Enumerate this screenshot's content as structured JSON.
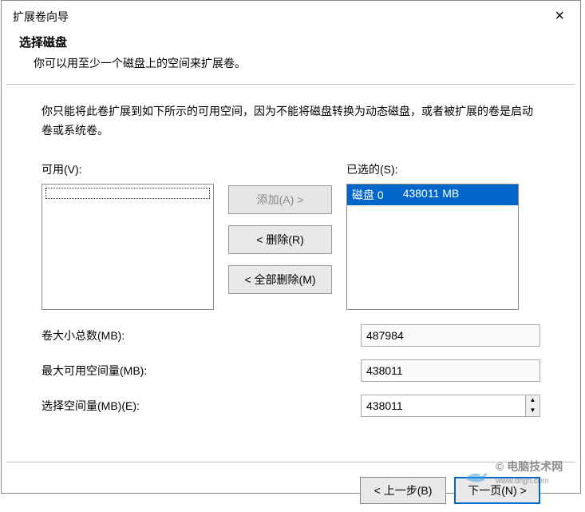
{
  "window": {
    "title": "扩展卷向导",
    "close_icon": "×"
  },
  "header": {
    "title": "选择磁盘",
    "description": "你可以用至少一个磁盘上的空间来扩展卷。"
  },
  "info": "你只能将此卷扩展到如下所示的可用空间，因为不能将磁盘转换为动态磁盘，或者被扩展的卷是启动卷或系统卷。",
  "available": {
    "label": "可用(V):"
  },
  "selected": {
    "label": "已选的(S):",
    "items": [
      {
        "disk": "磁盘 0",
        "size": "438011 MB"
      }
    ]
  },
  "buttons": {
    "add": "添加(A) >",
    "remove": "< 删除(R)",
    "remove_all": "< 全部删除(M)"
  },
  "fields": {
    "total_size": {
      "label": "卷大小总数(MB):",
      "value": "487984"
    },
    "max_available": {
      "label": "最大可用空间量(MB):",
      "value": "438011"
    },
    "select_space": {
      "label": "选择空间量(MB)(E):",
      "value": "438011"
    }
  },
  "footer": {
    "back": "< 上一步(B)",
    "next": "下一页(N) >"
  },
  "watermark": {
    "text_top": "© 电脑技术网",
    "text_bottom": "www.dnjjn.com"
  }
}
